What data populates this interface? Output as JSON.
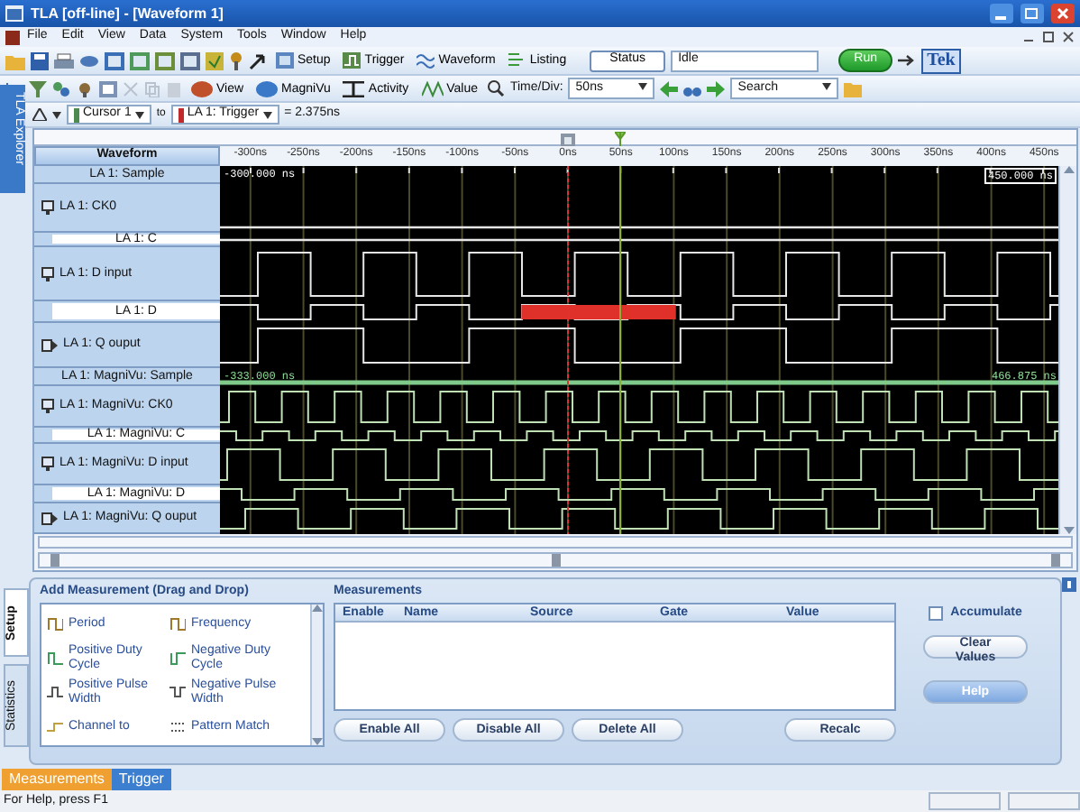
{
  "window": {
    "title": "TLA [off-line] - [Waveform 1]"
  },
  "menu": [
    "File",
    "Edit",
    "View",
    "Data",
    "System",
    "Tools",
    "Window",
    "Help"
  ],
  "toolbar": {
    "buttons": [
      "Setup",
      "Trigger",
      "Waveform",
      "Listing"
    ],
    "status_label": "Status",
    "status_value": "Idle",
    "run_button": "Run",
    "logo": "Tek"
  },
  "toolbar2": {
    "buttons": [
      "View",
      "MagniVu",
      "Activity",
      "Value"
    ],
    "time_div_label": "Time/Div:",
    "time_div_value": "50ns",
    "search_value": "Search"
  },
  "cursor_bar": {
    "from": "Cursor 1",
    "to_label": "to",
    "to": "LA 1: Trigger",
    "delta": "= 2.375ns"
  },
  "side_tab": "TLA Explorer",
  "waveform": {
    "header": "Waveform",
    "ticks": [
      "-300ns",
      "-250ns",
      "-200ns",
      "-150ns",
      "-100ns",
      "-50ns",
      "0ns",
      "50ns",
      "100ns",
      "150ns",
      "200ns",
      "250ns",
      "300ns",
      "350ns",
      "400ns",
      "450ns"
    ],
    "signals": [
      {
        "name": "LA 1: Sample",
        "kind": "sample",
        "start": "-300.000 ns",
        "end": "450.000 ns"
      },
      {
        "name": "LA 1: CK0",
        "kind": "input"
      },
      {
        "name": "LA 1: C",
        "kind": "channel"
      },
      {
        "name": "LA 1: D input",
        "kind": "input"
      },
      {
        "name": "LA 1: D",
        "kind": "channel"
      },
      {
        "name": "LA 1: Q ouput",
        "kind": "output"
      },
      {
        "name": "LA 1: MagniVu: Sample",
        "kind": "sample",
        "start": "-333.000 ns",
        "end": "466.875 ns"
      },
      {
        "name": "LA 1: MagniVu: CK0",
        "kind": "input"
      },
      {
        "name": "LA 1: MagniVu: C",
        "kind": "channel"
      },
      {
        "name": "LA 1: MagniVu: D input",
        "kind": "input"
      },
      {
        "name": "LA 1: MagniVu: D",
        "kind": "channel"
      },
      {
        "name": "LA 1: MagniVu: Q ouput",
        "kind": "output"
      }
    ]
  },
  "bottom_panel": {
    "tabs": [
      {
        "label": "Setup",
        "selected": true
      },
      {
        "label": "Statistics",
        "selected": false
      }
    ],
    "add_title": "Add Measurement (Drag and Drop)",
    "items": [
      "Period",
      "Frequency",
      "Positive Duty Cycle",
      "Negative Duty Cycle",
      "Positive Pulse Width",
      "Negative Pulse Width",
      "Channel to",
      "Pattern Match"
    ],
    "measurements_title": "Measurements",
    "columns": [
      "Enable",
      "Name",
      "Source",
      "Gate",
      "Value"
    ],
    "buttons": [
      "Enable All",
      "Disable All",
      "Delete All",
      "Recalc"
    ],
    "accumulate": {
      "label": "Accumulate",
      "checked": false
    },
    "side_buttons": [
      "Clear Values",
      "Help"
    ]
  },
  "bottom_tabs": [
    {
      "label": "Measurements",
      "selected": true
    },
    {
      "label": "Trigger",
      "selected": false
    }
  ],
  "status_bar": "For Help, press F1"
}
